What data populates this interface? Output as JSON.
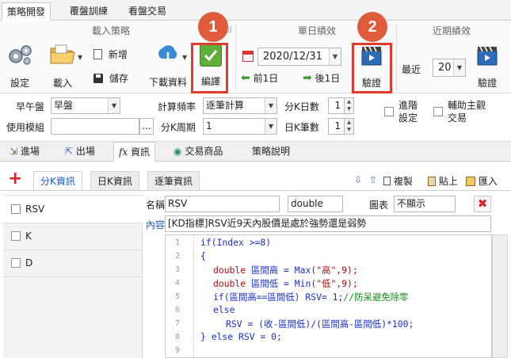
{
  "menu_tabs": [
    "策略開發",
    "覆盤訓練",
    "看盤交易"
  ],
  "ribbon": {
    "group_load": "載入策略",
    "group_daily": "單日績效",
    "group_recent": "近期績效",
    "settings_label": "設定",
    "load_label": "載入",
    "new_label": "新增",
    "save_label": "儲存",
    "download_label": "下載資料",
    "compile_label": "編譯",
    "date_value": "2020/12/31",
    "prev_day_label": "前1日",
    "next_day_label": "後1日",
    "verify_label": "驗證",
    "recent_label": "最近",
    "recent_value": "20",
    "recent_verify_label": "驗證",
    "badge1": "1",
    "badge2": "2"
  },
  "settings": {
    "session_label": "早午盤",
    "session_value": "早盤",
    "freq_label": "計算頻率",
    "freq_value": "逐筆計算",
    "min_k_days_label": "分K日數",
    "min_k_days_value": "1",
    "advanced_label": "進階設定",
    "aux_label": "輔助主觀交易",
    "module_label": "使用模組",
    "module_value": "",
    "browse_label": "...",
    "min_k_period_label": "分K周期",
    "min_k_period_value": "1",
    "day_k_count_label": "日K筆數",
    "day_k_count_value": "1"
  },
  "strategy_tabs": [
    "進場",
    "出場",
    "資訊",
    "交易商品",
    "策略說明"
  ],
  "info": {
    "subtabs": [
      "分K資訊",
      "日K資訊",
      "逐筆資訊"
    ],
    "copy_label": "複製",
    "paste_label": "貼上",
    "import_label": "匯入",
    "list_items": [
      "RSV",
      "K",
      "D"
    ],
    "name_label": "名稱",
    "name_value": "RSV",
    "type_value": "double",
    "chart_label": "圖表",
    "chart_value": "不顯示",
    "content_label": "內容",
    "content_value": "[KD指標]RSV近9天內股價是處於強勢還是弱勢"
  },
  "code": {
    "line_numbers": [
      "1",
      "2",
      "3",
      "4",
      "5",
      "6",
      "7",
      "8",
      "9"
    ],
    "line1": "if(Index >=8)",
    "line2": "{",
    "line3_kw": "double",
    "line3_rest": " 區間高 = ",
    "line3_fn": "Max",
    "line3_args": "(\"高\",9);",
    "line4_kw": "double",
    "line4_rest": " 區間低 = ",
    "line4_fn": "Min",
    "line4_args": "(\"低\",9);",
    "line5_code": "if(區間高==區間低) RSV= 1;",
    "line5_comment": "//防呆避免除零",
    "line6": "else",
    "line7": "RSV = (收-區間低)/(區間高-區間低)*100;",
    "line8": "} else RSV = 0;",
    "line9": ""
  },
  "colors": {
    "accent_red": "#e23a2c",
    "badge": "#e05a3c",
    "keyword_blue": "#1a2fd0",
    "comment_green": "#1a8a1a",
    "tab_blue": "#1a56b8"
  }
}
